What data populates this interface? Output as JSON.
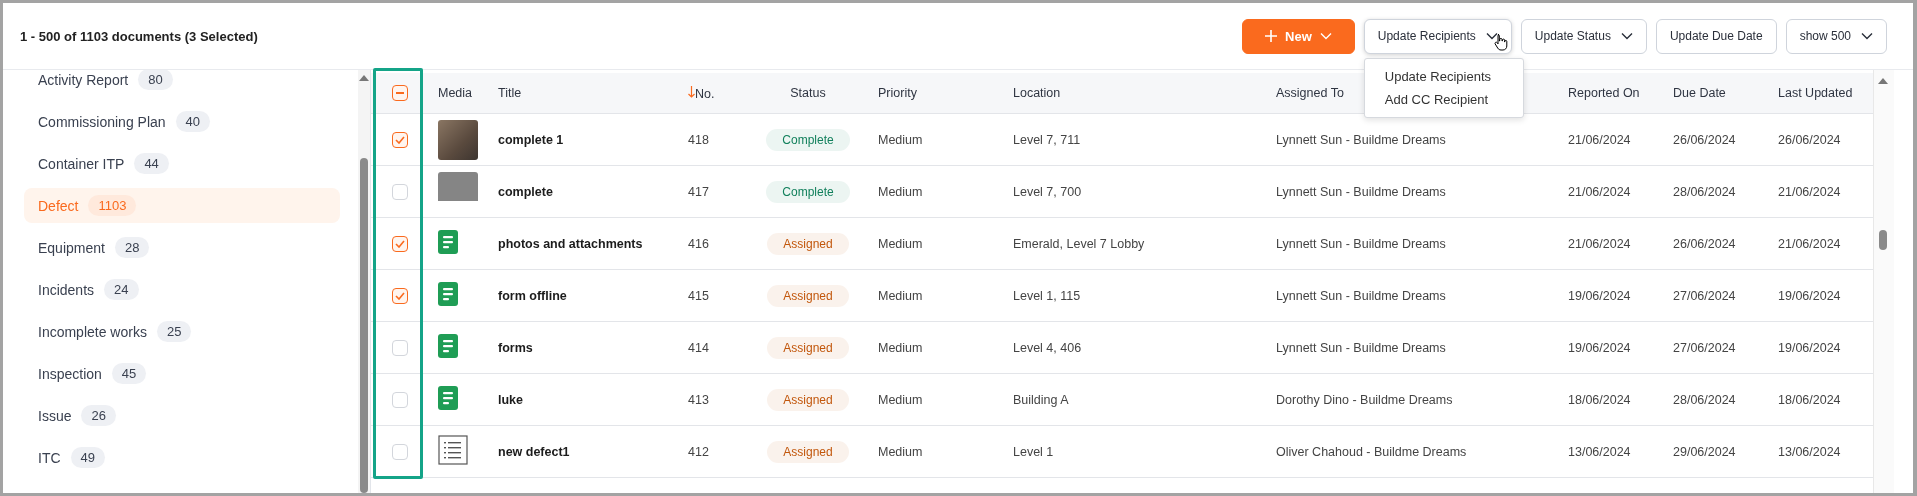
{
  "header": {
    "summary": "1 - 500 of 1103 documents (3 Selected)"
  },
  "toolbar": {
    "buttons": [
      {
        "kind": "primary",
        "label": "New",
        "expanded": false
      },
      {
        "kind": "dropdown",
        "label": "Update Recipients",
        "expanded": true,
        "menu": [
          "Update Recipients",
          "Add CC Recipient"
        ]
      },
      {
        "kind": "dropdown",
        "label": "Update Status",
        "expanded": false
      },
      {
        "kind": "plain",
        "label": "Update Due Date",
        "expanded": false
      },
      {
        "kind": "dropdown",
        "label": "show 500",
        "expanded": false
      }
    ]
  },
  "sidebar": {
    "items": [
      {
        "label": "Activity Report",
        "count": "80",
        "selected": false
      },
      {
        "label": "Commissioning Plan",
        "count": "40",
        "selected": false
      },
      {
        "label": "Container ITP",
        "count": "44",
        "selected": false
      },
      {
        "label": "Defect",
        "count": "1103",
        "selected": true
      },
      {
        "label": "Equipment",
        "count": "28",
        "selected": false
      },
      {
        "label": "Incidents",
        "count": "24",
        "selected": false
      },
      {
        "label": "Incomplete works",
        "count": "25",
        "selected": false
      },
      {
        "label": "Inspection",
        "count": "45",
        "selected": false
      },
      {
        "label": "Issue",
        "count": "26",
        "selected": false
      },
      {
        "label": "ITC",
        "count": "49",
        "selected": false
      }
    ]
  },
  "table": {
    "select_all": {
      "partial": true
    },
    "columns": [
      {
        "label": "Media",
        "sorted": false
      },
      {
        "label": "Title",
        "sorted": false
      },
      {
        "label": "No.",
        "sorted": true
      },
      {
        "label": "Status",
        "sorted": false
      },
      {
        "label": "Priority",
        "sorted": false
      },
      {
        "label": "Location",
        "sorted": false
      },
      {
        "label": "Assigned To",
        "sorted": false
      },
      {
        "label": "Reported On",
        "sorted": false
      },
      {
        "label": "Due Date",
        "sorted": false
      },
      {
        "label": "Last Updated",
        "sorted": false
      }
    ],
    "rows": [
      {
        "checked": true,
        "media": {
          "kind": "photo"
        },
        "title": "complete 1",
        "no": "418",
        "status": {
          "text": "Complete",
          "color": "#12805c"
        },
        "priority": "Medium",
        "location": "Level 7, 711",
        "assigned_to": "Lynnett Sun - Buildme Dreams",
        "reported_on": "21/06/2024",
        "due_date": "26/06/2024",
        "last_updated": "26/06/2024"
      },
      {
        "checked": false,
        "media": {
          "kind": "screenshot"
        },
        "title": "complete",
        "no": "417",
        "status": {
          "text": "Complete",
          "color": "#12805c"
        },
        "priority": "Medium",
        "location": "Level 7, 700",
        "assigned_to": "Lynnett Sun - Buildme Dreams",
        "reported_on": "21/06/2024",
        "due_date": "28/06/2024",
        "last_updated": "21/06/2024"
      },
      {
        "checked": true,
        "media": {
          "kind": "form"
        },
        "title": "photos and attachments",
        "no": "416",
        "status": {
          "text": "Assigned",
          "color": "#c2570c"
        },
        "priority": "Medium",
        "location": "Emerald, Level 7 Lobby",
        "assigned_to": "Lynnett Sun - Buildme Dreams",
        "reported_on": "21/06/2024",
        "due_date": "26/06/2024",
        "last_updated": "21/06/2024"
      },
      {
        "checked": true,
        "media": {
          "kind": "form"
        },
        "title": "form offline",
        "no": "415",
        "status": {
          "text": "Assigned",
          "color": "#c2570c"
        },
        "priority": "Medium",
        "location": "Level 1, 115",
        "assigned_to": "Lynnett Sun - Buildme Dreams",
        "reported_on": "19/06/2024",
        "due_date": "27/06/2024",
        "last_updated": "19/06/2024"
      },
      {
        "checked": false,
        "media": {
          "kind": "form"
        },
        "title": "forms",
        "no": "414",
        "status": {
          "text": "Assigned",
          "color": "#c2570c"
        },
        "priority": "Medium",
        "location": "Level 4, 406",
        "assigned_to": "Lynnett Sun - Buildme Dreams",
        "reported_on": "19/06/2024",
        "due_date": "27/06/2024",
        "last_updated": "19/06/2024"
      },
      {
        "checked": false,
        "media": {
          "kind": "form"
        },
        "title": "luke",
        "no": "413",
        "status": {
          "text": "Assigned",
          "color": "#c2570c"
        },
        "priority": "Medium",
        "location": "Building A",
        "assigned_to": "Dorothy Dino - Buildme Dreams",
        "reported_on": "18/06/2024",
        "due_date": "28/06/2024",
        "last_updated": "18/06/2024"
      },
      {
        "checked": false,
        "media": {
          "kind": "list"
        },
        "title": "new defect1",
        "no": "412",
        "status": {
          "text": "Assigned",
          "color": "#c2570c"
        },
        "priority": "Medium",
        "location": "Level 1",
        "assigned_to": "Oliver Chahoud - Buildme Dreams",
        "reported_on": "13/06/2024",
        "due_date": "29/06/2024",
        "last_updated": "13/06/2024"
      }
    ]
  }
}
